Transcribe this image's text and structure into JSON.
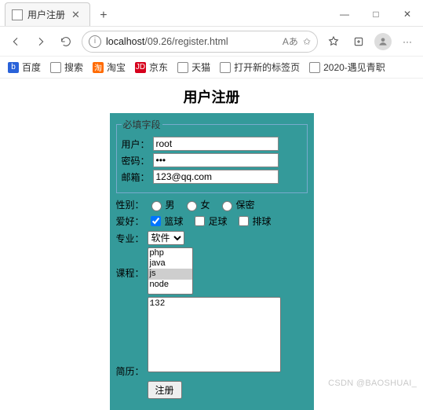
{
  "browser": {
    "tab_title": "用户注册",
    "new_tab_plus": "+",
    "url_host": "localhost",
    "url_path": "/09.26/register.html",
    "window": {
      "min": "—",
      "max": "□",
      "close": "✕"
    }
  },
  "bookmarks": {
    "baidu": "百度",
    "sousuo": "搜索",
    "taobao": "淘宝",
    "jd": "京东",
    "tmall": "天猫",
    "new_tab": "打开新的标签页",
    "qingzhi": "2020-遇见青职"
  },
  "page": {
    "title": "用户注册",
    "fieldset_legend": "必填字段",
    "labels": {
      "user": "用户：",
      "pass": "密码：",
      "email": "邮箱：",
      "gender": "性别：",
      "hobby": "爱好：",
      "major": "专业：",
      "course": "课程：",
      "resume": "简历："
    },
    "values": {
      "user": "root",
      "pass": "•••",
      "email": "123@qq.com",
      "textarea": "132"
    },
    "gender": {
      "male": "男",
      "female": "女",
      "secret": "保密"
    },
    "hobby": {
      "basketball": "篮球",
      "football": "足球",
      "volleyball": "排球"
    },
    "major_selected": "软件",
    "courses": [
      "php",
      "java",
      "js",
      "node"
    ],
    "submit": "注册"
  },
  "watermark": "CSDN @BAOSHUAI_"
}
